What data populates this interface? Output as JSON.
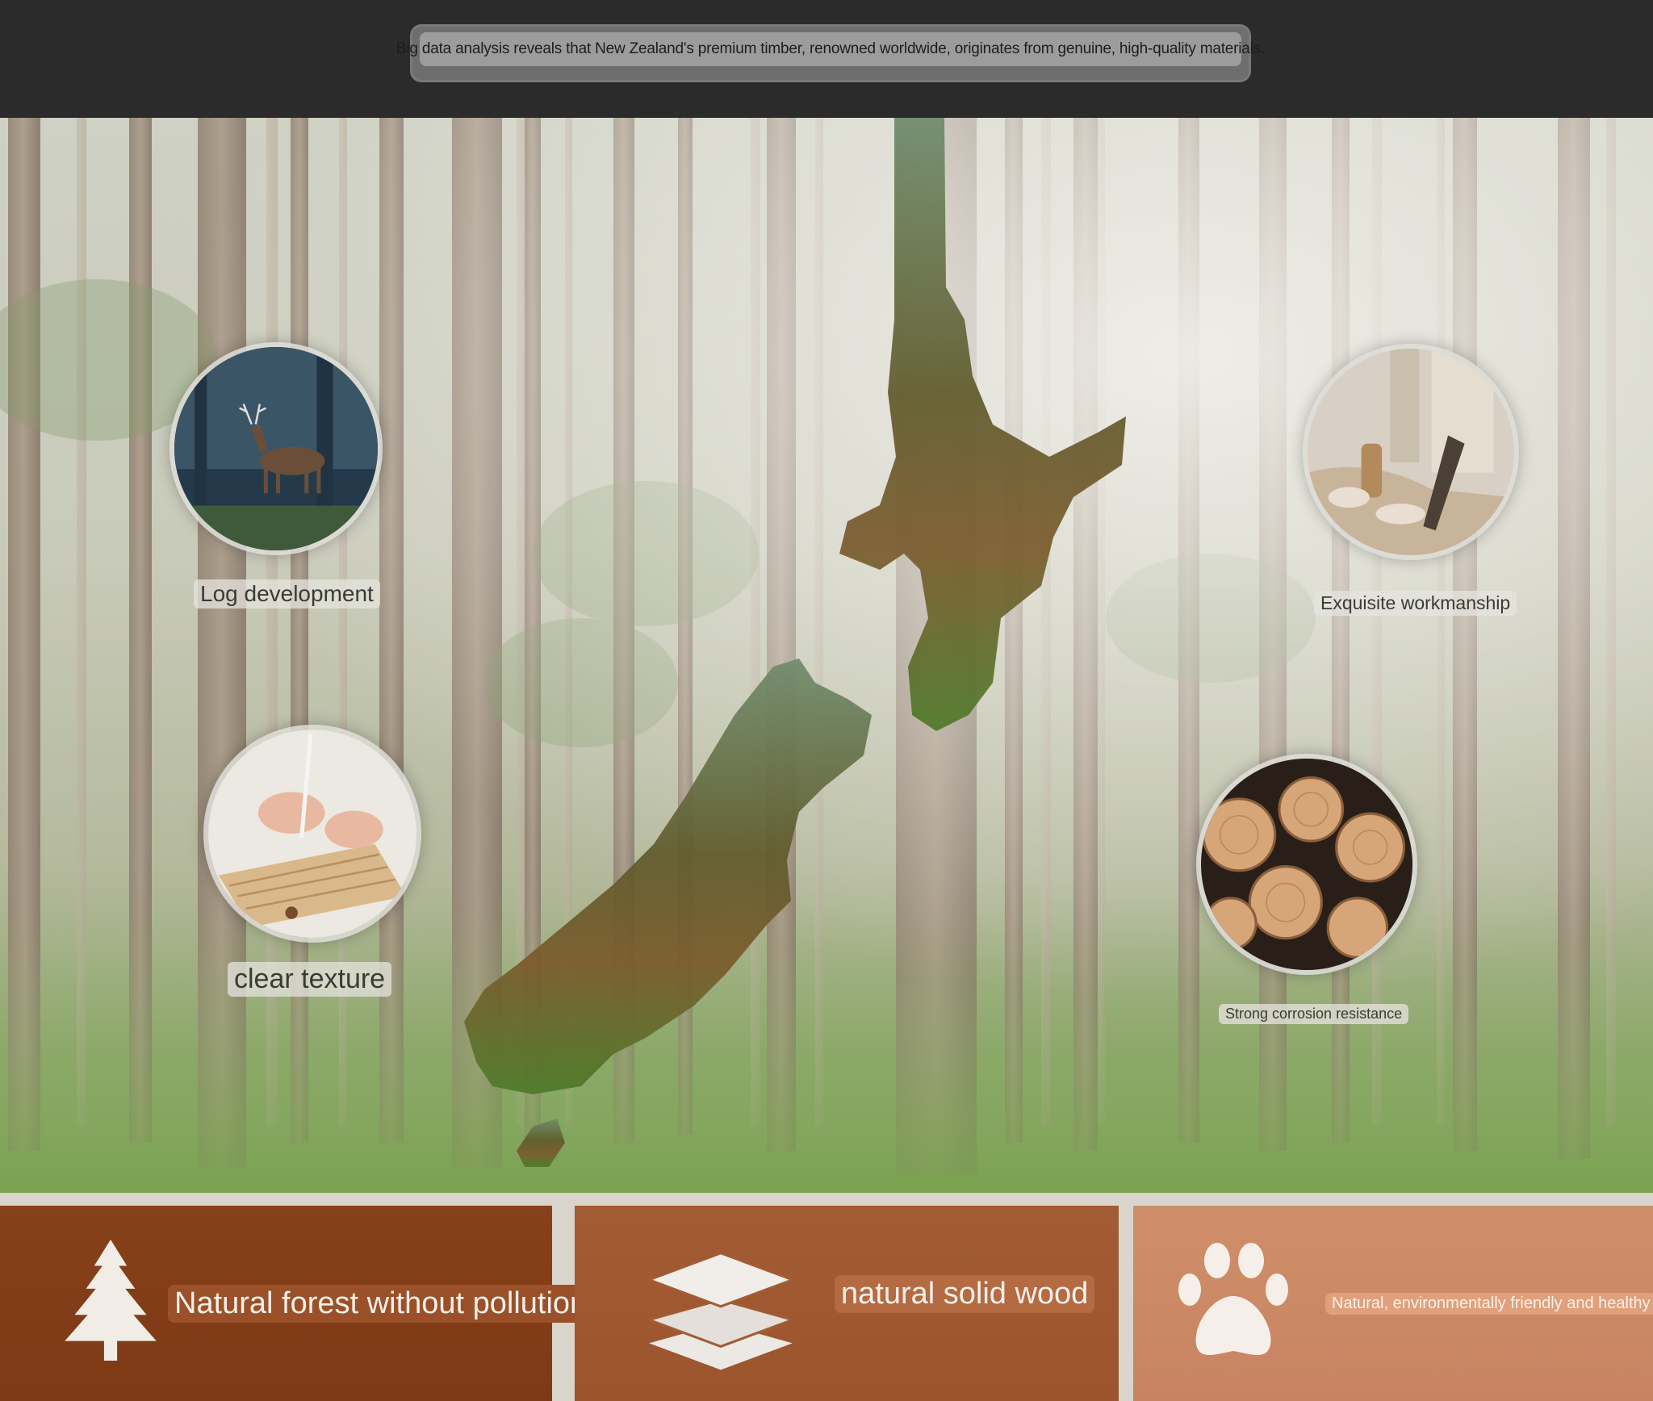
{
  "header": {
    "caption": "Big data analysis reveals that New Zealand's premium timber, renowned worldwide, originates from genuine, high-quality materials."
  },
  "features": {
    "log_development": "Log development",
    "clear_texture": "clear texture",
    "exquisite_workmanship": "Exquisite workmanship",
    "strong_corrosion_resistance": "Strong corrosion resistance"
  },
  "panels": {
    "natural_forest": "Natural forest without pollution",
    "natural_solid_wood": "natural solid wood",
    "natural_healthy": "Natural, environmentally friendly and healthy"
  },
  "icons": {
    "panel1": "pine-tree-icon",
    "panel2": "layers-icon",
    "panel3": "paw-icon"
  },
  "colors": {
    "panel1": "#843e18",
    "panel2": "#a05a32",
    "panel3": "#cc8a66",
    "header": "#2b2b2b"
  }
}
